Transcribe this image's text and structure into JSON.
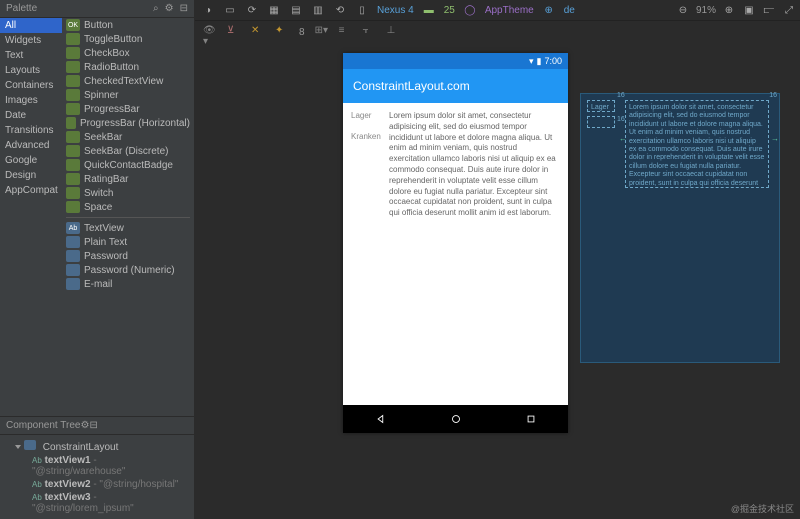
{
  "palette": {
    "title": "Palette",
    "categories": [
      "All",
      "Widgets",
      "Text",
      "Layouts",
      "Containers",
      "Images",
      "Date",
      "Transitions",
      "Advanced",
      "Google",
      "Design",
      "AppCompat"
    ],
    "widgets_a": [
      {
        "l": "Button",
        "t": "OK"
      },
      {
        "l": "ToggleButton",
        "t": ""
      },
      {
        "l": "CheckBox",
        "t": ""
      },
      {
        "l": "RadioButton",
        "t": ""
      },
      {
        "l": "CheckedTextView",
        "t": ""
      },
      {
        "l": "Spinner",
        "t": ""
      },
      {
        "l": "ProgressBar",
        "t": ""
      },
      {
        "l": "ProgressBar (Horizontal)",
        "t": ""
      },
      {
        "l": "SeekBar",
        "t": ""
      },
      {
        "l": "SeekBar (Discrete)",
        "t": ""
      },
      {
        "l": "QuickContactBadge",
        "t": ""
      },
      {
        "l": "RatingBar",
        "t": ""
      },
      {
        "l": "Switch",
        "t": ""
      },
      {
        "l": "Space",
        "t": ""
      }
    ],
    "widgets_b": [
      {
        "l": "TextView",
        "t": "Ab"
      },
      {
        "l": "Plain Text",
        "t": ""
      },
      {
        "l": "Password",
        "t": ""
      },
      {
        "l": "Password (Numeric)",
        "t": ""
      },
      {
        "l": "E-mail",
        "t": ""
      }
    ]
  },
  "tree": {
    "title": "Component Tree",
    "root": "ConstraintLayout",
    "items": [
      {
        "n": "textView1",
        "v": "\"@string/warehouse\""
      },
      {
        "n": "textView2",
        "v": "\"@string/hospital\""
      },
      {
        "n": "textView3",
        "v": "\"@string/lorem_ipsum\""
      }
    ]
  },
  "toolbar": {
    "device": "Nexus 4",
    "api": "25",
    "theme": "AppTheme",
    "locale": "de",
    "zoom": "91%"
  },
  "subbar": {
    "dp": "8",
    "unit": "dp"
  },
  "phone": {
    "time": "7:00",
    "title": "ConstraintLayout.com",
    "label1": "Lager",
    "label2": "Kranken",
    "lorem": "Lorem ipsum dolor sit amet, consectetur adipisicing elit, sed do eiusmod tempor incididunt ut labore et dolore magna aliqua. Ut enim ad minim veniam, quis nostrud exercitation ullamco laboris nisi ut aliquip ex ea commodo consequat. Duis aute irure dolor in reprehenderit in voluptate velit esse cillum dolore eu fugiat nulla pariatur. Excepteur sint occaecat cupidatat non proident, sunt in culpa qui officia deserunt mollit anim id est laborum."
  },
  "blueprint": {
    "m": "16",
    "lorem": "Lorem ipsum dolor sit amet, consectetur adipisicing elit, sed do eiusmod tempor incididunt ut labore et dolore magna aliqua. Ut enim ad minim veniam, quis nostrud exercitation ullamco laboris nisi ut aliquip ex ea commodo consequat. Duis aute irure dolor in reprehenderit in voluptate velit esse cillum dolore eu fugiat nulla pariatur. Excepteur sint occaecat cupidatat non proident, sunt in culpa qui officia deserunt mollit anim id est laborum."
  },
  "footer": "@掘金技术社区"
}
